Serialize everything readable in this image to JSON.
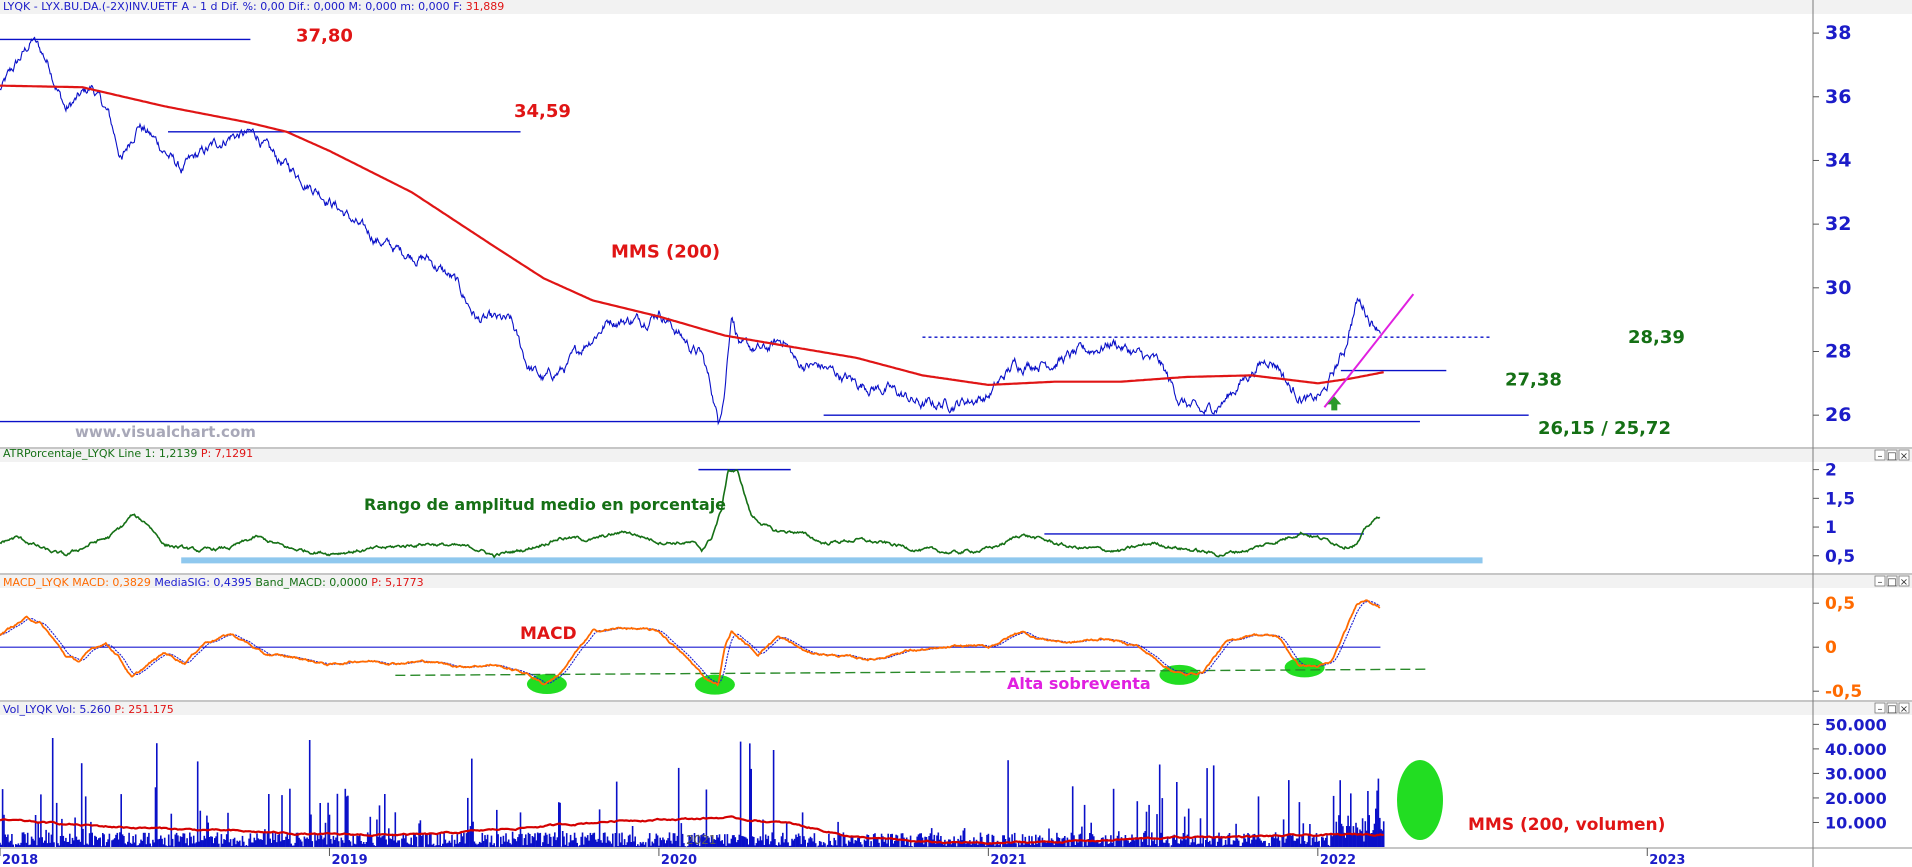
{
  "colors": {
    "price": "#0a10c8",
    "mms": "#e01515",
    "atr": "#157015",
    "macd": "#ff6a00",
    "signal": "#1a1ad0",
    "volume": "#0a10c8",
    "volma": "#d40000",
    "label_red": "#e01515",
    "label_green": "#157015",
    "label_magenta": "#e020e0",
    "highlight": "#22dd22",
    "band": "#8fc8ee",
    "axis_text": "#1c1cc8",
    "grid": "#9a9a9a"
  },
  "header": {
    "price_info": "LYQK - LYX.BU.DA.(-2X)INV.UETF A - 1 d Dif. %: 0,00 Dif.: 0,000 M: 0,000 m: 0,000 F:",
    "price_last": "31,889",
    "atr_info": "ATRPorcentaje_LYQK Line 1: 1,2139",
    "atr_last": "P: 7,1291",
    "macd_info": "MACD_LYQK MACD: 0,3829",
    "macd_sig": "MediaSIG: 0,4395",
    "macd_band": "Band_MACD: 0,0000",
    "macd_last": "P: 5,1773",
    "vol_info": "Vol_LYQK Vol: 5.260",
    "vol_last": "P: 251.175"
  },
  "window_buttons": [
    "–",
    "□",
    "×"
  ],
  "watermark": "www.visualchart.com",
  "vol_small_label": "2021",
  "x_axis": {
    "labels": [
      "2018",
      "2019",
      "2020",
      "2021",
      "2022",
      "2023"
    ]
  },
  "chart_data": [
    {
      "type": "line",
      "title": "",
      "ylim": [
        25,
        38.6
      ],
      "y_ticks": [
        26,
        28,
        30,
        32,
        34,
        36,
        38
      ],
      "y_tick_labels": [
        "26",
        "28",
        "30",
        "32",
        "34",
        "36",
        "38"
      ],
      "price_anchors": [
        [
          2018.0,
          36.2
        ],
        [
          2018.05,
          37.0
        ],
        [
          2018.1,
          37.8
        ],
        [
          2018.15,
          37.0
        ],
        [
          2018.2,
          35.6
        ],
        [
          2018.28,
          36.3
        ],
        [
          2018.33,
          35.4
        ],
        [
          2018.37,
          34.0
        ],
        [
          2018.42,
          35.2
        ],
        [
          2018.5,
          34.3
        ],
        [
          2018.55,
          33.7
        ],
        [
          2018.6,
          34.1
        ],
        [
          2018.7,
          34.8
        ],
        [
          2018.78,
          34.8
        ],
        [
          2018.82,
          34.2
        ],
        [
          2018.9,
          33.6
        ],
        [
          2019.0,
          32.8
        ],
        [
          2019.1,
          31.8
        ],
        [
          2019.2,
          31.2
        ],
        [
          2019.3,
          30.9
        ],
        [
          2019.38,
          30.2
        ],
        [
          2019.45,
          29.0
        ],
        [
          2019.55,
          28.9
        ],
        [
          2019.6,
          27.6
        ],
        [
          2019.65,
          27.1
        ],
        [
          2019.72,
          27.5
        ],
        [
          2019.78,
          28.3
        ],
        [
          2019.85,
          29.0
        ],
        [
          2019.95,
          29.0
        ],
        [
          2020.0,
          29.3
        ],
        [
          2020.05,
          28.7
        ],
        [
          2020.1,
          28.1
        ],
        [
          2020.13,
          27.9
        ],
        [
          2020.16,
          26.8
        ],
        [
          2020.18,
          25.8
        ],
        [
          2020.2,
          26.9
        ],
        [
          2020.22,
          29.3
        ],
        [
          2020.25,
          28.1
        ],
        [
          2020.32,
          28.0
        ],
        [
          2020.38,
          28.4
        ],
        [
          2020.42,
          27.6
        ],
        [
          2020.5,
          27.5
        ],
        [
          2020.6,
          27.0
        ],
        [
          2020.7,
          26.8
        ],
        [
          2020.8,
          26.3
        ],
        [
          2020.9,
          26.4
        ],
        [
          2021.0,
          26.6
        ],
        [
          2021.08,
          27.6
        ],
        [
          2021.2,
          27.7
        ],
        [
          2021.3,
          28.0
        ],
        [
          2021.38,
          28.3
        ],
        [
          2021.45,
          27.9
        ],
        [
          2021.52,
          27.6
        ],
        [
          2021.58,
          26.5
        ],
        [
          2021.65,
          26.0
        ],
        [
          2021.72,
          26.5
        ],
        [
          2021.78,
          27.2
        ],
        [
          2021.85,
          27.8
        ],
        [
          2021.88,
          27.6
        ],
        [
          2021.92,
          26.8
        ],
        [
          2021.98,
          26.4
        ],
        [
          2022.02,
          26.7
        ],
        [
          2022.06,
          27.6
        ],
        [
          2022.08,
          28.0
        ],
        [
          2022.1,
          28.9
        ],
        [
          2022.12,
          29.6
        ],
        [
          2022.14,
          29.4
        ],
        [
          2022.16,
          29.0
        ],
        [
          2022.19,
          28.8
        ]
      ],
      "mms_anchors": [
        [
          2018.0,
          36.35
        ],
        [
          2018.25,
          36.3
        ],
        [
          2018.5,
          35.7
        ],
        [
          2018.75,
          35.2
        ],
        [
          2018.87,
          34.9
        ],
        [
          2019.0,
          34.3
        ],
        [
          2019.25,
          33.0
        ],
        [
          2019.5,
          31.3
        ],
        [
          2019.65,
          30.3
        ],
        [
          2019.8,
          29.6
        ],
        [
          2020.0,
          29.1
        ],
        [
          2020.2,
          28.5
        ],
        [
          2020.4,
          28.15
        ],
        [
          2020.6,
          27.8
        ],
        [
          2020.8,
          27.25
        ],
        [
          2021.0,
          26.95
        ],
        [
          2021.2,
          27.05
        ],
        [
          2021.4,
          27.05
        ],
        [
          2021.6,
          27.2
        ],
        [
          2021.8,
          27.25
        ],
        [
          2022.0,
          27.0
        ],
        [
          2022.1,
          27.15
        ],
        [
          2022.2,
          27.35
        ]
      ],
      "levels": [
        {
          "label": "37,80",
          "value": 37.8,
          "x_start": 2018.0,
          "x_end": 2018.76
        },
        {
          "label": "34,59",
          "value": 34.9,
          "x_start": 2018.51,
          "x_end": 2019.58
        },
        {
          "label": "28,39",
          "value": 28.45,
          "x_start": 2020.8,
          "x_end": 2022.53,
          "dashed": true
        },
        {
          "label": "27,38",
          "value": 27.4,
          "x_start": 2022.07,
          "x_end": 2022.39
        },
        {
          "label": "26,15 / 25,72",
          "value": 26.0,
          "x_start": 2020.5,
          "x_end": 2022.64
        },
        {
          "label": "",
          "value": 25.8,
          "x_start": 1919.0,
          "x_end": 2022.31
        }
      ],
      "series_label": "MMS (200)",
      "trendline": {
        "x1": 2022.02,
        "y1": 26.25,
        "x2": 2022.29,
        "y2": 29.8
      }
    },
    {
      "type": "line",
      "ylim": [
        0.2,
        2.15
      ],
      "y_ticks": [
        0.5,
        1,
        1.5,
        2
      ],
      "y_tick_labels": [
        "0,5",
        "1",
        "1,5",
        "2"
      ],
      "atr_anchors": [
        [
          2018.0,
          0.73
        ],
        [
          2018.05,
          0.82
        ],
        [
          2018.1,
          0.7
        ],
        [
          2018.15,
          0.57
        ],
        [
          2018.2,
          0.5
        ],
        [
          2018.28,
          0.72
        ],
        [
          2018.33,
          0.82
        ],
        [
          2018.37,
          1.0
        ],
        [
          2018.4,
          1.2
        ],
        [
          2018.45,
          1.05
        ],
        [
          2018.5,
          0.7
        ],
        [
          2018.6,
          0.58
        ],
        [
          2018.7,
          0.64
        ],
        [
          2018.78,
          0.82
        ],
        [
          2018.88,
          0.62
        ],
        [
          2019.0,
          0.55
        ],
        [
          2019.15,
          0.62
        ],
        [
          2019.3,
          0.72
        ],
        [
          2019.45,
          0.62
        ],
        [
          2019.5,
          0.5
        ],
        [
          2019.6,
          0.62
        ],
        [
          2019.7,
          0.82
        ],
        [
          2019.8,
          0.78
        ],
        [
          2019.9,
          0.92
        ],
        [
          2020.0,
          0.75
        ],
        [
          2020.1,
          0.72
        ],
        [
          2020.13,
          0.6
        ],
        [
          2020.16,
          0.82
        ],
        [
          2020.19,
          1.3
        ],
        [
          2020.21,
          2.0
        ],
        [
          2020.24,
          1.95
        ],
        [
          2020.28,
          1.2
        ],
        [
          2020.35,
          0.92
        ],
        [
          2020.42,
          0.92
        ],
        [
          2020.5,
          0.72
        ],
        [
          2020.6,
          0.78
        ],
        [
          2020.7,
          0.7
        ],
        [
          2020.8,
          0.6
        ],
        [
          2020.9,
          0.55
        ],
        [
          2021.0,
          0.62
        ],
        [
          2021.05,
          0.72
        ],
        [
          2021.1,
          0.88
        ],
        [
          2021.15,
          0.8
        ],
        [
          2021.25,
          0.65
        ],
        [
          2021.4,
          0.58
        ],
        [
          2021.5,
          0.72
        ],
        [
          2021.6,
          0.62
        ],
        [
          2021.7,
          0.52
        ],
        [
          2021.8,
          0.62
        ],
        [
          2021.9,
          0.8
        ],
        [
          2021.95,
          0.92
        ],
        [
          2022.0,
          0.82
        ],
        [
          2022.08,
          0.68
        ],
        [
          2022.12,
          0.72
        ],
        [
          2022.15,
          1.0
        ],
        [
          2022.19,
          1.2
        ]
      ],
      "levels": [
        {
          "label": "",
          "value": 2.0,
          "x_start": 2020.12,
          "x_end": 2020.4
        },
        {
          "label": "",
          "value": 0.88,
          "x_start": 2021.17,
          "x_end": 2022.14
        }
      ],
      "band": {
        "value": 0.42,
        "x_start": 2018.55,
        "x_end": 2022.5
      },
      "series_label": "Rango de amplitud medio en porcentaje"
    },
    {
      "type": "line",
      "ylim": [
        -0.6,
        0.65
      ],
      "y_ticks": [
        -0.5,
        0,
        0.5
      ],
      "y_tick_labels": [
        "-0,5",
        "0",
        "0,5"
      ],
      "macd_anchors": [
        [
          2018.0,
          0.14
        ],
        [
          2018.04,
          0.24
        ],
        [
          2018.08,
          0.33
        ],
        [
          2018.12,
          0.28
        ],
        [
          2018.16,
          0.1
        ],
        [
          2018.2,
          -0.1
        ],
        [
          2018.24,
          -0.16
        ],
        [
          2018.28,
          -0.02
        ],
        [
          2018.32,
          0.05
        ],
        [
          2018.36,
          -0.1
        ],
        [
          2018.4,
          -0.35
        ],
        [
          2018.45,
          -0.2
        ],
        [
          2018.5,
          -0.06
        ],
        [
          2018.56,
          -0.18
        ],
        [
          2018.62,
          0.05
        ],
        [
          2018.7,
          0.15
        ],
        [
          2018.75,
          0.05
        ],
        [
          2018.8,
          -0.08
        ],
        [
          2018.9,
          -0.12
        ],
        [
          2019.0,
          -0.2
        ],
        [
          2019.1,
          -0.15
        ],
        [
          2019.2,
          -0.18
        ],
        [
          2019.3,
          -0.16
        ],
        [
          2019.4,
          -0.22
        ],
        [
          2019.5,
          -0.2
        ],
        [
          2019.55,
          -0.25
        ],
        [
          2019.6,
          -0.3
        ],
        [
          2019.65,
          -0.42
        ],
        [
          2019.7,
          -0.3
        ],
        [
          2019.75,
          -0.05
        ],
        [
          2019.8,
          0.18
        ],
        [
          2019.9,
          0.22
        ],
        [
          2020.0,
          0.18
        ],
        [
          2020.05,
          0.0
        ],
        [
          2020.1,
          -0.18
        ],
        [
          2020.14,
          -0.35
        ],
        [
          2020.18,
          -0.42
        ],
        [
          2020.2,
          0.0
        ],
        [
          2020.22,
          0.18
        ],
        [
          2020.26,
          0.05
        ],
        [
          2020.3,
          -0.08
        ],
        [
          2020.36,
          0.12
        ],
        [
          2020.4,
          0.05
        ],
        [
          2020.45,
          -0.06
        ],
        [
          2020.55,
          -0.1
        ],
        [
          2020.65,
          -0.14
        ],
        [
          2020.75,
          -0.04
        ],
        [
          2020.85,
          -0.02
        ],
        [
          2020.95,
          0.02
        ],
        [
          2021.0,
          0.0
        ],
        [
          2021.1,
          0.18
        ],
        [
          2021.15,
          0.1
        ],
        [
          2021.25,
          0.05
        ],
        [
          2021.35,
          0.1
        ],
        [
          2021.45,
          0.02
        ],
        [
          2021.55,
          -0.25
        ],
        [
          2021.6,
          -0.32
        ],
        [
          2021.65,
          -0.28
        ],
        [
          2021.72,
          0.05
        ],
        [
          2021.8,
          0.15
        ],
        [
          2021.88,
          0.12
        ],
        [
          2021.94,
          -0.2
        ],
        [
          2022.0,
          -0.22
        ],
        [
          2022.04,
          -0.18
        ],
        [
          2022.08,
          0.15
        ],
        [
          2022.12,
          0.5
        ],
        [
          2022.15,
          0.55
        ],
        [
          2022.19,
          0.45
        ]
      ],
      "dashed_support": {
        "x1": 2019.2,
        "y1": -0.32,
        "x2": 2022.33,
        "y2": -0.25
      },
      "highlights": [
        2019.66,
        2020.17,
        2021.58,
        2021.96
      ],
      "series_label": "MACD",
      "annotation": "Alta sobreventa"
    },
    {
      "type": "bar",
      "ylim": [
        0,
        53000
      ],
      "y_ticks": [
        10000,
        20000,
        30000,
        40000,
        50000
      ],
      "y_tick_labels": [
        "10.000",
        "20.000",
        "30.000",
        "40.000",
        "50.000"
      ],
      "vol_ma_anchors": [
        [
          2018.0,
          11000
        ],
        [
          2018.3,
          8500
        ],
        [
          2018.7,
          6500
        ],
        [
          2019.0,
          5000
        ],
        [
          2019.3,
          5000
        ],
        [
          2019.6,
          8000
        ],
        [
          2019.9,
          11000
        ],
        [
          2020.1,
          11500
        ],
        [
          2020.2,
          12000
        ],
        [
          2020.4,
          9500
        ],
        [
          2020.6,
          4000
        ],
        [
          2020.8,
          2000
        ],
        [
          2021.0,
          1500
        ],
        [
          2021.3,
          2500
        ],
        [
          2021.6,
          4000
        ],
        [
          2021.9,
          4500
        ],
        [
          2022.1,
          5000
        ],
        [
          2022.2,
          5500
        ]
      ],
      "series_label": "MMS (200, volumen)"
    }
  ]
}
